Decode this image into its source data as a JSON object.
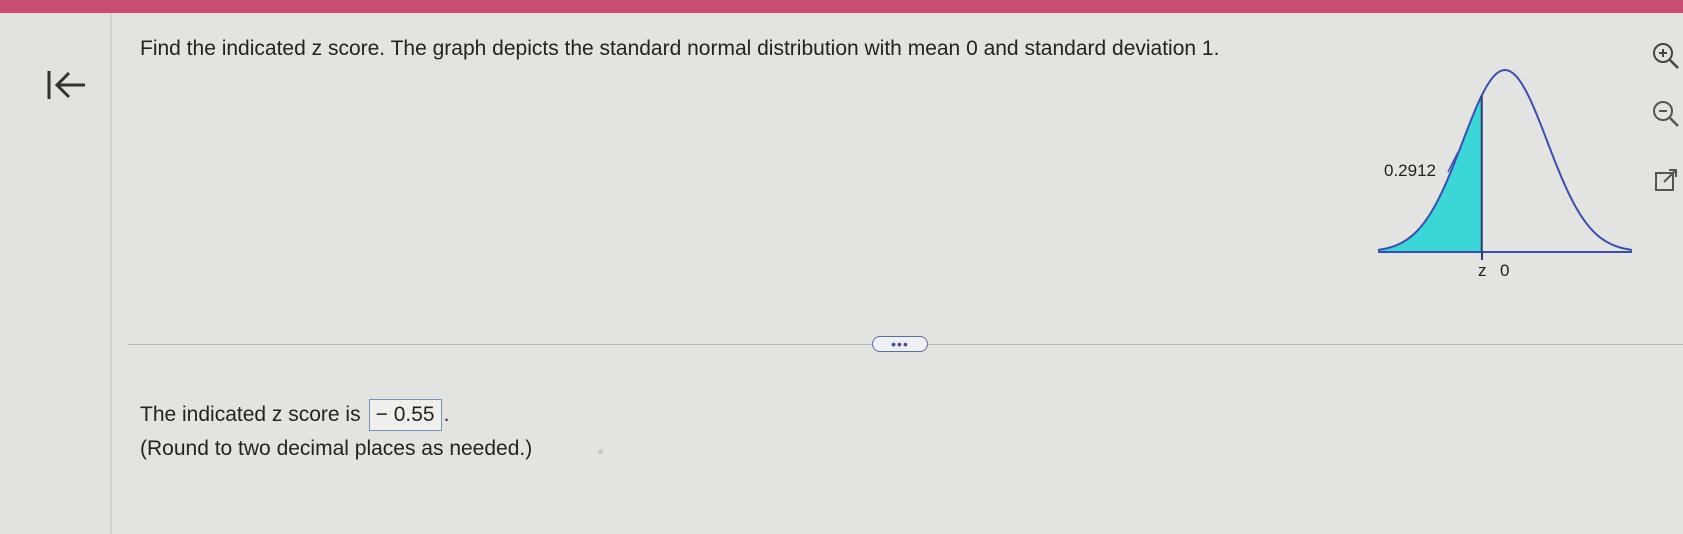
{
  "question": {
    "text": "Find the indicated z score. The graph depicts the standard normal distribution with mean 0 and standard deviation 1."
  },
  "graph": {
    "area_label": "0.2912",
    "z_label": "z",
    "mean_label": "0",
    "shade_color": "#3bd6d6",
    "curve_color": "#3b4fb0",
    "shaded_area": 0.2912
  },
  "toolbar": {
    "back_icon": "collapse-left-icon",
    "zoom_in_icon": "zoom-in-icon",
    "zoom_out_icon": "zoom-out-icon",
    "open_icon": "open-external-icon"
  },
  "more_button": {
    "label": "•••"
  },
  "answer": {
    "prefix": "The indicated z score is",
    "value": "− 0.55",
    "suffix": ".",
    "hint": "(Round to two decimal places as needed.)"
  },
  "colors": {
    "topbar": "#c94d72",
    "background": "#e3e3e1"
  }
}
